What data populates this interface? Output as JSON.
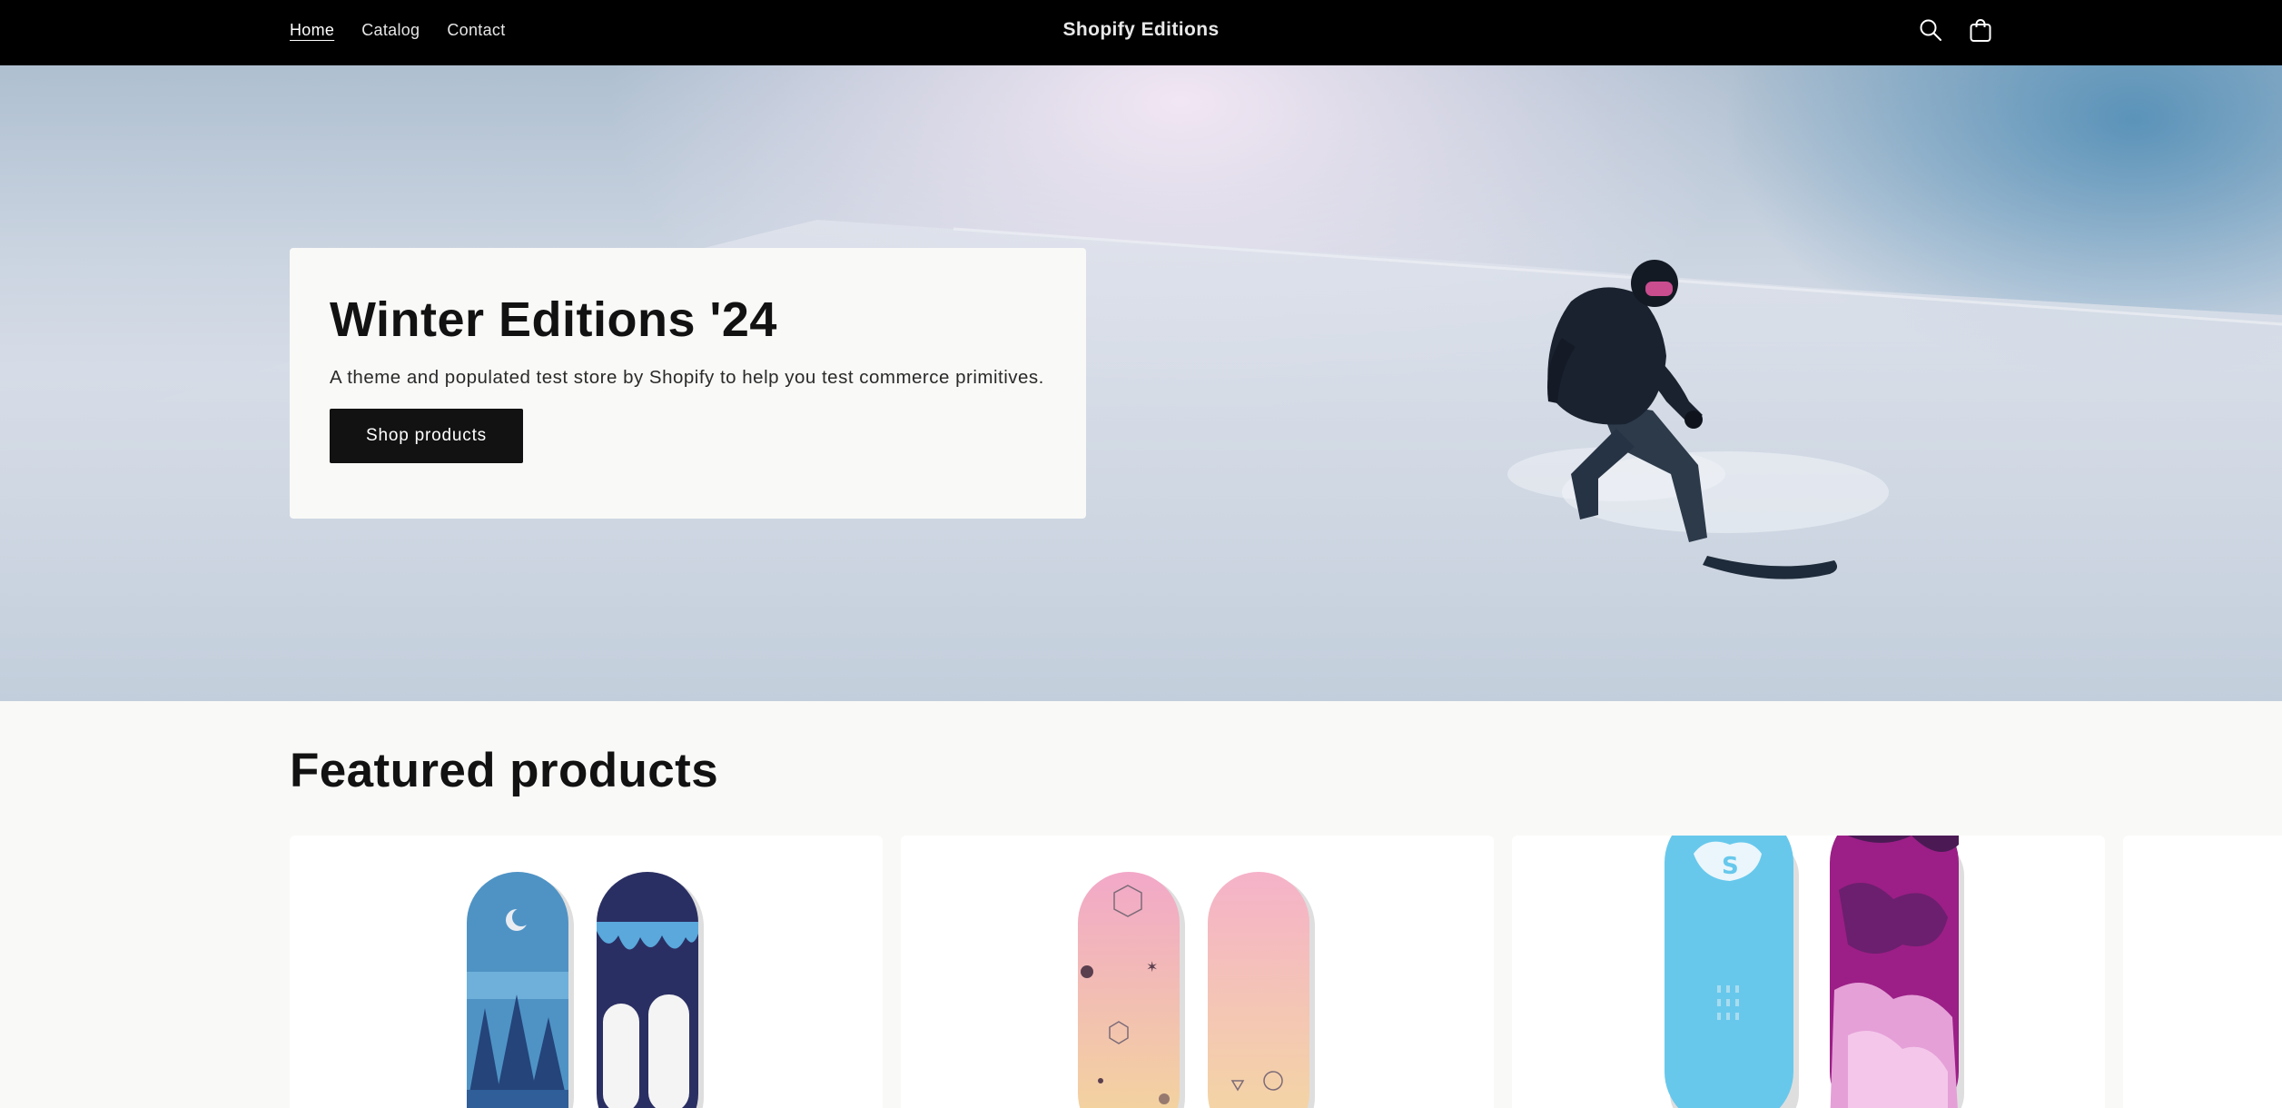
{
  "header": {
    "nav": [
      {
        "label": "Home",
        "active": true
      },
      {
        "label": "Catalog",
        "active": false
      },
      {
        "label": "Contact",
        "active": false
      }
    ],
    "brand": "Shopify Editions",
    "icons": {
      "search": "search-icon",
      "cart": "cart-icon"
    }
  },
  "hero": {
    "title": "Winter Editions '24",
    "subtitle": "A theme and populated test store by Shopify to help you test commerce primitives.",
    "button_label": "Shop products"
  },
  "featured": {
    "title": "Featured products",
    "products": [
      {
        "image": "snowboard-pair-blue-forest"
      },
      {
        "image": "snowboard-pair-pastel-pink"
      },
      {
        "image": "snowboard-pair-light-blue-magenta"
      }
    ]
  },
  "colors": {
    "header_bg": "#000000",
    "page_bg": "#f9f9f7",
    "button_bg": "#121212"
  }
}
